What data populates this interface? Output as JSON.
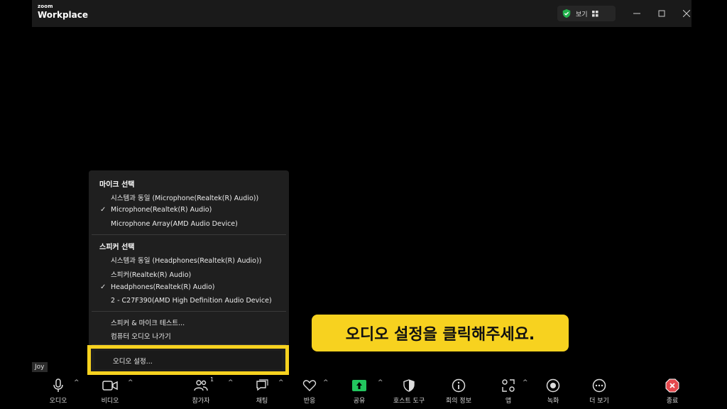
{
  "app": {
    "logo_small": "zoom",
    "logo_big": "Workplace",
    "view_button": "보기"
  },
  "audio_menu": {
    "mic_section": "마이크 선택",
    "mic_items": [
      {
        "label": "시스템과 동일 (Microphone(Realtek(R) Audio))",
        "checked": false
      },
      {
        "label": "Microphone(Realtek(R) Audio)",
        "checked": true
      },
      {
        "label": "Microphone Array(AMD Audio Device)",
        "checked": false
      }
    ],
    "speaker_section": "스피커 선택",
    "speaker_items": [
      {
        "label": "시스템과 동일 (Headphones(Realtek(R) Audio))",
        "checked": false
      },
      {
        "label": "스피커(Realtek(R) Audio)",
        "checked": false
      },
      {
        "label": "Headphones(Realtek(R) Audio)",
        "checked": true
      },
      {
        "label": "2 - C27F390(AMD High Definition Audio Device)",
        "checked": false
      }
    ],
    "test_label": "스피커 & 마이크 테스트...",
    "leave_label": "컴퓨터 오디오 나가기",
    "settings_label": "오디오 설정...",
    "check_mark": "✓"
  },
  "callout_text": "오디오 설정을 클릭해주세요.",
  "participant_name": "Joy",
  "toolbar": {
    "audio": "오디오",
    "video": "비디오",
    "participants": "참가자",
    "participants_count": "1",
    "chat": "채팅",
    "reactions": "반응",
    "share": "공유",
    "host_tools": "호스트 도구",
    "meeting_info": "회의 정보",
    "apps": "앱",
    "record": "녹화",
    "more": "더 보기",
    "end": "종료",
    "caret": "^"
  },
  "colors": {
    "highlight": "#f7d21f",
    "share_green": "#22c55e",
    "end_red": "#e5484d",
    "shield_green": "#22b14c"
  }
}
